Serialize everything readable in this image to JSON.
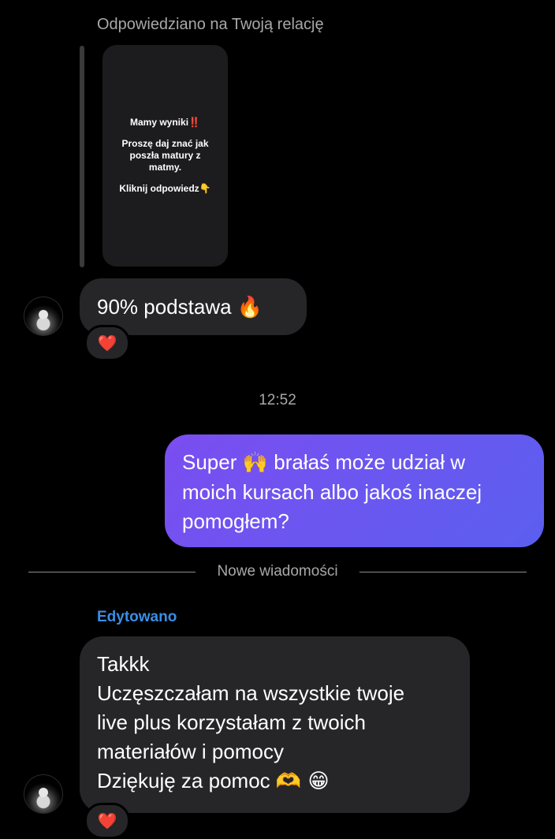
{
  "thread": {
    "reply_context": "Odpowiedziano na Twoją relację",
    "story": {
      "line1": "Mamy wyniki",
      "line1_mark": "‼️",
      "line2": "Proszę daj znać jak poszła matury z matmy.",
      "line3": "Kliknij odpowiedz",
      "line3_emoji": "👇"
    },
    "message1": {
      "text": "90% podstawa",
      "emoji": "🔥",
      "reaction": "❤️"
    },
    "timestamp": "12:52",
    "outgoing": {
      "line1_a": "Super",
      "line1_emoji": "🙌",
      "line1_b": "brałaś może udział w",
      "line2": "moich kursach albo jakoś inaczej",
      "line3": "pomogłem?"
    },
    "divider": "Nowe wiadomości",
    "edited_label": "Edytowano",
    "message2": {
      "lines": [
        "Takkk",
        "Uczęszczałam na wszystkie twoje",
        "live plus korzystałam z twoich",
        "materiałów i pomocy"
      ],
      "last_line": "Dziękuję za pomoc",
      "last_emojis": "🫶 😁",
      "reaction": "❤️"
    }
  },
  "colors": {
    "background": "#000000",
    "incoming_bubble": "#262629",
    "outgoing_gradient_start": "#7b4df0",
    "outgoing_gradient_end": "#5b5ff0",
    "edited_label": "#3a8ee6",
    "muted_text": "#a8a8a8"
  }
}
